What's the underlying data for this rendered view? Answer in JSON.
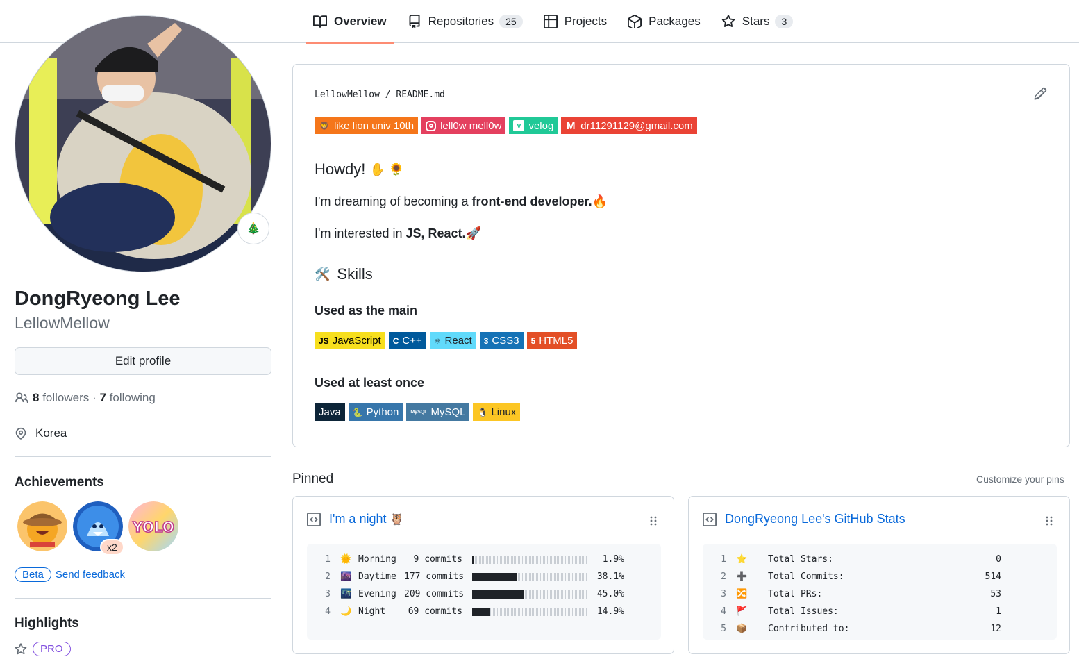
{
  "tabs": [
    {
      "label": "Overview",
      "count": null
    },
    {
      "label": "Repositories",
      "count": "25"
    },
    {
      "label": "Projects",
      "count": null
    },
    {
      "label": "Packages",
      "count": null
    },
    {
      "label": "Stars",
      "count": "3"
    }
  ],
  "profile": {
    "name": "DongRyeong Lee",
    "login": "LellowMellow",
    "status_emoji": "🎄",
    "edit_label": "Edit profile",
    "followers_count": "8",
    "followers_label": "followers",
    "separator": "·",
    "following_count": "7",
    "following_label": "following",
    "location": "Korea"
  },
  "achievements": {
    "title": "Achievements",
    "multiplier": "x2",
    "beta_label": "Beta",
    "feedback_label": "Send feedback",
    "yolo_text": "YOLO"
  },
  "highlights": {
    "title": "Highlights",
    "pro_label": "PRO"
  },
  "readme": {
    "owner": "LellowMellow",
    "slash": "/",
    "file": "README.md",
    "badges": [
      {
        "label": "like lion univ 10th",
        "color": "#f5761a",
        "icon": "lion"
      },
      {
        "label": "lell0w mell0w",
        "color": "#e4405f",
        "icon": "instagram"
      },
      {
        "label": "velog",
        "color": "#20c997",
        "icon": "v"
      },
      {
        "label": "dr11291129@gmail.com",
        "color": "#ea4335",
        "icon": "M"
      }
    ],
    "howdy": "Howdy!",
    "howdy_emojis": "✋ 🌻",
    "p1_prefix": "I'm dreaming of becoming a ",
    "p1_bold": "front-end developer.",
    "p1_emoji": "🔥",
    "p2_prefix": "I'm interested in ",
    "p2_bold": "JS, React.",
    "p2_emoji": "🚀",
    "skills_emoji": "🛠️",
    "skills_title": "Skills",
    "main_title": "Used as the main",
    "once_title": "Used at least once",
    "main_skills": [
      {
        "label": "JavaScript",
        "bg": "#f7df1e",
        "fg": "#000000",
        "icon": "JS"
      },
      {
        "label": "C++",
        "bg": "#00599c",
        "fg": "#ffffff",
        "icon": "C"
      },
      {
        "label": "React",
        "bg": "#61dafb",
        "fg": "#1f2328",
        "icon": "⚛"
      },
      {
        "label": "CSS3",
        "bg": "#1572b6",
        "fg": "#ffffff",
        "icon": "3"
      },
      {
        "label": "HTML5",
        "bg": "#e34f26",
        "fg": "#ffffff",
        "icon": "5"
      }
    ],
    "once_skills": [
      {
        "label": "Java",
        "bg": "#0d2538",
        "fg": "#ffffff",
        "icon": ""
      },
      {
        "label": "Python",
        "bg": "#3776ab",
        "fg": "#ffffff",
        "icon": "🐍"
      },
      {
        "label": "MySQL",
        "bg": "#4479a1",
        "fg": "#ffffff",
        "icon": "MySQL"
      },
      {
        "label": "Linux",
        "bg": "#fcc624",
        "fg": "#1f2328",
        "icon": "🐧"
      }
    ]
  },
  "pinned": {
    "title": "Pinned",
    "customize": "Customize your pins",
    "cards": [
      {
        "title": "I'm a night",
        "title_emoji": "🦉",
        "rows": [
          {
            "num": "1",
            "emoji": "🌞",
            "label": "Morning",
            "commits": "9 commits",
            "pct": "1.9%",
            "value": 1.9
          },
          {
            "num": "2",
            "emoji": "🌆",
            "label": "Daytime",
            "commits": "177 commits",
            "pct": "38.1%",
            "value": 38.1
          },
          {
            "num": "3",
            "emoji": "🌃",
            "label": "Evening",
            "commits": "209 commits",
            "pct": "45.0%",
            "value": 45.0
          },
          {
            "num": "4",
            "emoji": "🌙",
            "label": "Night",
            "commits": "69 commits",
            "pct": "14.9%",
            "value": 14.9
          }
        ]
      },
      {
        "title": "DongRyeong Lee's GitHub Stats",
        "rows": [
          {
            "num": "1",
            "emoji": "⭐",
            "label": "Total Stars:",
            "value": "0"
          },
          {
            "num": "2",
            "emoji": "➕",
            "label": "Total Commits:",
            "value": "514"
          },
          {
            "num": "3",
            "emoji": "🔀",
            "label": "Total PRs:",
            "value": "53"
          },
          {
            "num": "4",
            "emoji": "🚩",
            "label": "Total Issues:",
            "value": "1"
          },
          {
            "num": "5",
            "emoji": "📦",
            "label": "Contributed to:",
            "value": "12"
          }
        ]
      }
    ]
  }
}
